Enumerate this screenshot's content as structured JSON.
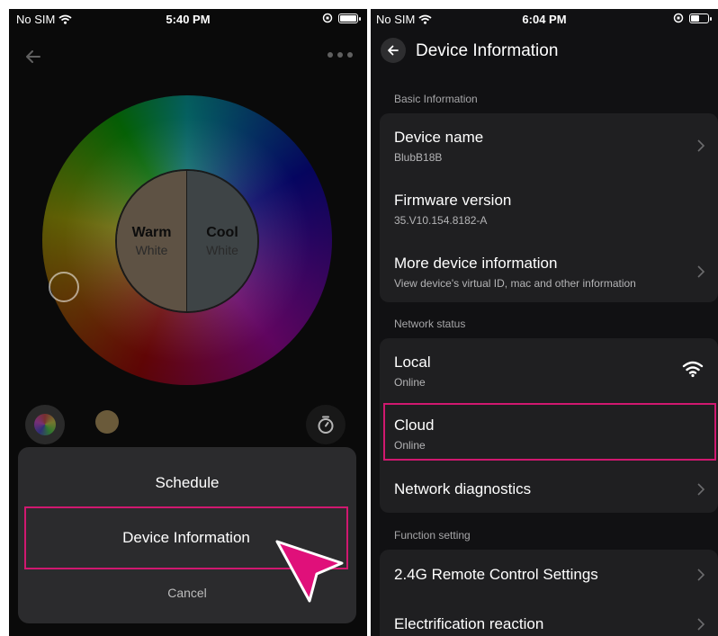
{
  "left": {
    "status": {
      "carrier": "No SIM",
      "time": "5:40 PM"
    },
    "wheel": {
      "warm_title": "Warm",
      "warm_sub": "White",
      "cool_title": "Cool",
      "cool_sub": "White"
    },
    "sheet": {
      "schedule": "Schedule",
      "device_info": "Device Information",
      "cancel": "Cancel"
    },
    "colors": {
      "highlight": "#d0186f",
      "pointer": "#e0107a"
    }
  },
  "right": {
    "status": {
      "carrier": "No SIM",
      "time": "6:04 PM"
    },
    "header": {
      "title": "Device Information"
    },
    "basic": {
      "label": "Basic Information",
      "device_name_title": "Device name",
      "device_name_value": "BlubB18B",
      "firmware_title": "Firmware version",
      "firmware_value": "35.V10.154.8182-A",
      "more_title": "More device information",
      "more_sub": "View device's virtual ID, mac and other information"
    },
    "network": {
      "label": "Network status",
      "local_title": "Local",
      "local_value": "Online",
      "cloud_title": "Cloud",
      "cloud_value": "Online",
      "diag_title": "Network diagnostics"
    },
    "function": {
      "label": "Function setting",
      "remote_title": "2.4G Remote Control Settings",
      "electrification_title": "Electrification reaction"
    }
  }
}
